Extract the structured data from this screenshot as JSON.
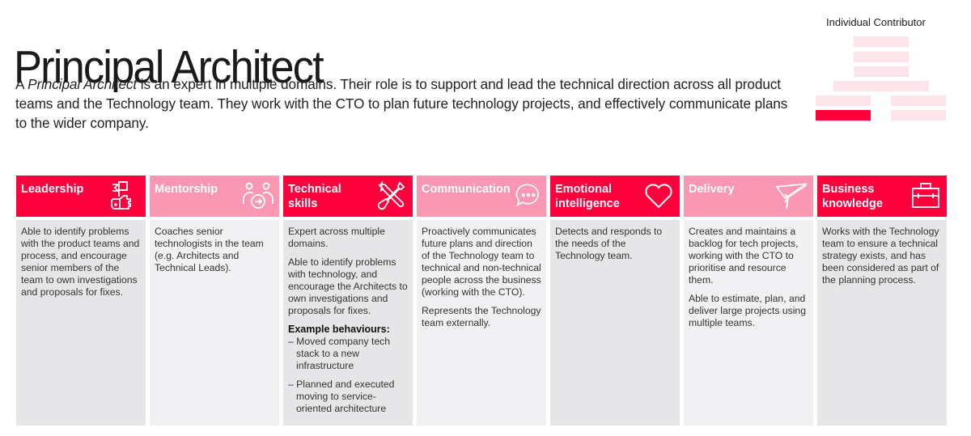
{
  "header": {
    "title": "Principal Architect",
    "intro_prefix": "A ",
    "intro_italic": "Principal Architect",
    "intro_rest": " is an expert in multiple domains. Their role is to support and lead the technical direction across all product teams and the Technology team. They work with the CTO to plan future technology projects, and effectively communicate plans to the wider company."
  },
  "career_ladder": {
    "label": "Individual Contributor",
    "levels": [
      {
        "name": "level-top-1",
        "active": false
      },
      {
        "name": "level-top-2",
        "active": false
      },
      {
        "name": "level-top-3",
        "active": false
      },
      {
        "name": "level-wide",
        "active": false
      },
      {
        "name": "level-left-upper",
        "active": false
      },
      {
        "name": "level-right-upper",
        "active": false
      },
      {
        "name": "level-left-lower",
        "active": true
      },
      {
        "name": "level-right-lower",
        "active": false
      }
    ],
    "active_color": "#ff003c",
    "inactive_color": "#fde3ea"
  },
  "colors": {
    "red": "#ff003c",
    "pink": "#fa98b4"
  },
  "columns": [
    {
      "title": "Leadership",
      "icon": "flag-thumbs-up-icon",
      "paragraphs": [
        "Able to identify problems with the product teams and process, and encourage senior members of the team to own investigations and proposals for fixes."
      ]
    },
    {
      "title": "Mentorship",
      "icon": "people-arrow-icon",
      "paragraphs": [
        "Coaches senior technologists in the team (e.g. Architects and Technical Leads)."
      ]
    },
    {
      "title": "Technical skills",
      "icon": "tools-icon",
      "paragraphs": [
        "Expert across multiple domains.",
        "Able to identify problems with technology, and encourage the Architects to own investigations and proposals for fixes."
      ],
      "examples_title": "Example behaviours:",
      "examples": [
        "– Moved company tech stack to a new infrastructure",
        "– Planned and executed moving to service-oriented architecture"
      ]
    },
    {
      "title": "Communication",
      "icon": "speech-bubble-icon",
      "paragraphs": [
        "Proactively communicates future plans and direction of the Technology team to technical and non-technical people across the business (working with the CTO).",
        "Represents the Technology team externally."
      ]
    },
    {
      "title": "Emotional intelligence",
      "icon": "heart-icon",
      "paragraphs": [
        "Detects and responds to the needs of the Technology team."
      ]
    },
    {
      "title": "Delivery",
      "icon": "paper-plane-icon",
      "paragraphs": [
        "Creates and maintains a backlog for tech projects, working with the CTO to prioritise and resource them.",
        "Able to estimate, plan, and deliver large projects using multiple teams."
      ]
    },
    {
      "title": "Business knowledge",
      "icon": "briefcase-icon",
      "paragraphs": [
        "Works with the Technology team to ensure a technical strategy exists, and has been considered as part of the planning process."
      ]
    }
  ]
}
